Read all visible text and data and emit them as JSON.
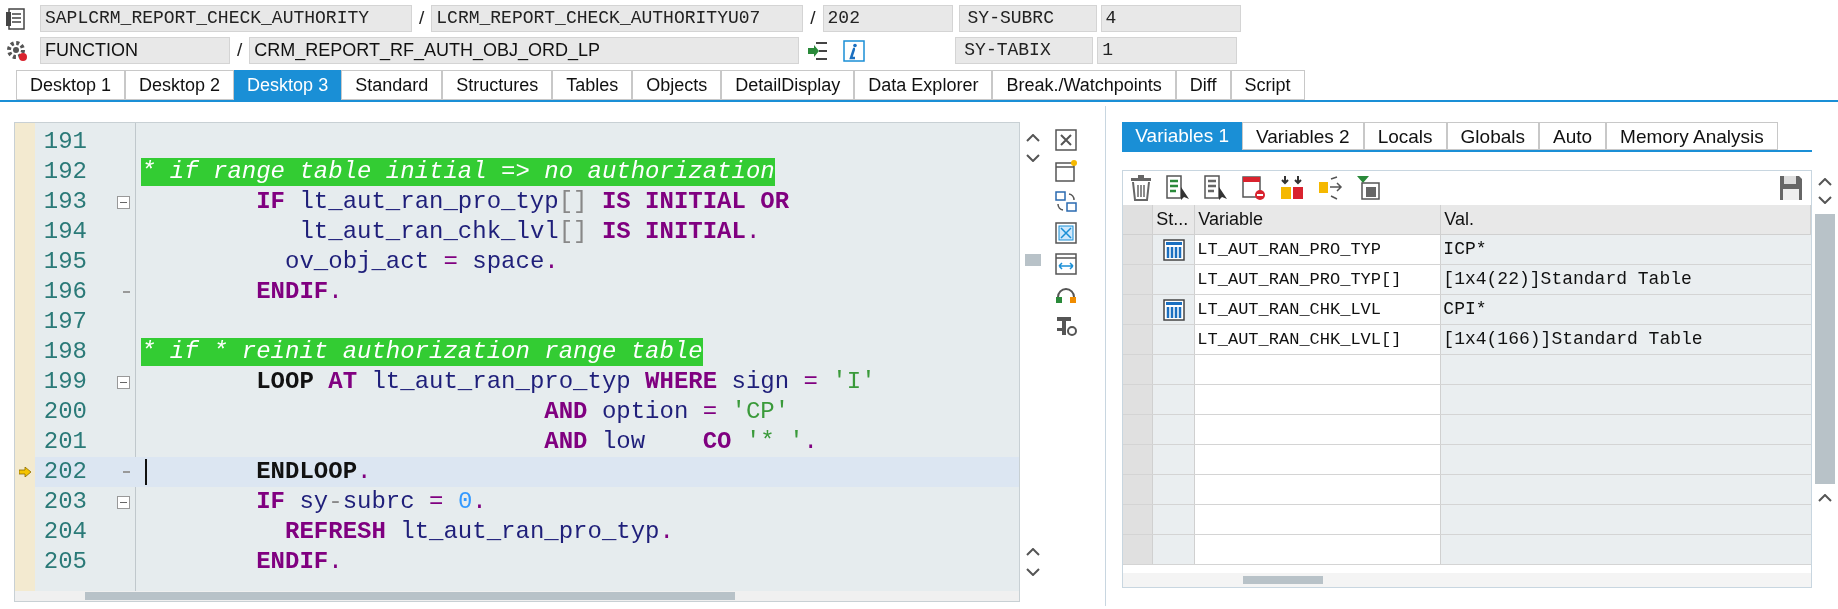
{
  "header": {
    "rows": [
      {
        "fields": [
          {
            "kind": "mono",
            "text": "SAPLCRM_REPORT_CHECK_AUTHORITY"
          },
          {
            "kind": "sep",
            "text": "/"
          },
          {
            "kind": "mono",
            "text": "LCRM_REPORT_CHECK_AUTHORITYU07"
          },
          {
            "kind": "sep",
            "text": "/"
          },
          {
            "kind": "mono",
            "text": "202"
          },
          {
            "kind": "label",
            "text": "SY-SUBRC"
          },
          {
            "kind": "mono",
            "text": "4"
          }
        ]
      },
      {
        "fields": [
          {
            "kind": "sans",
            "text": "FUNCTION"
          },
          {
            "kind": "sep",
            "text": "/"
          },
          {
            "kind": "sans",
            "text": "CRM_REPORT_RF_AUTH_OBJ_ORD_LP"
          },
          {
            "kind": "tools"
          },
          {
            "kind": "label",
            "text": "SY-TABIX"
          },
          {
            "kind": "mono",
            "text": "1"
          }
        ]
      }
    ]
  },
  "tabs": [
    {
      "label": "Desktop 1",
      "selected": false
    },
    {
      "label": "Desktop 2",
      "selected": false
    },
    {
      "label": "Desktop 3",
      "selected": true
    },
    {
      "label": "Standard",
      "selected": false
    },
    {
      "label": "Structures",
      "selected": false
    },
    {
      "label": "Tables",
      "selected": false
    },
    {
      "label": "Objects",
      "selected": false
    },
    {
      "label": "DetailDisplay",
      "selected": false
    },
    {
      "label": "Data Explorer",
      "selected": false
    },
    {
      "label": "Break./Watchpoints",
      "selected": false
    },
    {
      "label": "Diff",
      "selected": false
    },
    {
      "label": "Script",
      "selected": false
    }
  ],
  "code": {
    "lines": [
      {
        "number": "191",
        "current": false,
        "collapsible": false,
        "block_end": false
      },
      {
        "number": "192",
        "current": false,
        "collapsible": false,
        "block_end": false,
        "tokens": [
          {
            "kind": "comment",
            "text": "* if range table initial => no authorization"
          }
        ]
      },
      {
        "number": "193",
        "current": false,
        "collapsible": true,
        "block_end": false,
        "tokens": [
          {
            "kind": "kw",
            "text": "        IF"
          },
          {
            "kind": "id",
            "text": " lt_aut_ran_pro_typ"
          },
          {
            "kind": "gray",
            "text": "[]"
          },
          {
            "kind": "kw",
            "text": " IS INITIAL OR"
          }
        ]
      },
      {
        "number": "194",
        "current": false,
        "collapsible": false,
        "block_end": false,
        "tokens": [
          {
            "kind": "id",
            "text": "           lt_aut_ran_chk_lvl"
          },
          {
            "kind": "gray",
            "text": "[]"
          },
          {
            "kind": "kw",
            "text": " IS INITIAL"
          },
          {
            "kind": "op",
            "text": "."
          }
        ]
      },
      {
        "number": "195",
        "current": false,
        "collapsible": false,
        "block_end": false,
        "tokens": [
          {
            "kind": "id",
            "text": "          ov_obj_act"
          },
          {
            "kind": "op",
            "text": " ="
          },
          {
            "kind": "id",
            "text": " space"
          },
          {
            "kind": "op",
            "text": "."
          }
        ]
      },
      {
        "number": "196",
        "current": false,
        "collapsible": false,
        "block_end": true,
        "tokens": [
          {
            "kind": "kw",
            "text": "        ENDIF"
          },
          {
            "kind": "op",
            "text": "."
          }
        ]
      },
      {
        "number": "197",
        "current": false,
        "collapsible": false,
        "block_end": false
      },
      {
        "number": "198",
        "current": false,
        "collapsible": false,
        "block_end": false,
        "tokens": [
          {
            "kind": "comment",
            "text": "* if * reinit authorization range table"
          }
        ]
      },
      {
        "number": "199",
        "current": false,
        "collapsible": true,
        "block_end": false,
        "tokens": [
          {
            "kind": "kwb",
            "text": "        LOOP"
          },
          {
            "kind": "kw",
            "text": " AT"
          },
          {
            "kind": "id",
            "text": " lt_aut_ran_pro_typ"
          },
          {
            "kind": "kw",
            "text": " WHERE"
          },
          {
            "kind": "id",
            "text": " sign"
          },
          {
            "kind": "op",
            "text": " ="
          },
          {
            "kind": "str",
            "text": " 'I'"
          }
        ]
      },
      {
        "number": "200",
        "current": false,
        "collapsible": false,
        "block_end": false,
        "tokens": [
          {
            "kind": "kw",
            "text": "                            AND"
          },
          {
            "kind": "id",
            "text": " option"
          },
          {
            "kind": "op",
            "text": " ="
          },
          {
            "kind": "str",
            "text": " 'CP'"
          }
        ]
      },
      {
        "number": "201",
        "current": false,
        "collapsible": false,
        "block_end": false,
        "tokens": [
          {
            "kind": "kw",
            "text": "                            AND"
          },
          {
            "kind": "id",
            "text": " low"
          },
          {
            "kind": "kw",
            "text": "    CO"
          },
          {
            "kind": "str",
            "text": " '* '"
          },
          {
            "kind": "op",
            "text": "."
          }
        ]
      },
      {
        "number": "202",
        "current": true,
        "collapsible": false,
        "block_end": true,
        "tokens": [
          {
            "kind": "kwb",
            "text": "        ENDLOOP"
          },
          {
            "kind": "op",
            "text": "."
          }
        ]
      },
      {
        "number": "203",
        "current": false,
        "collapsible": true,
        "block_end": false,
        "tokens": [
          {
            "kind": "kw",
            "text": "        IF"
          },
          {
            "kind": "id",
            "text": " sy"
          },
          {
            "kind": "gray",
            "text": "-"
          },
          {
            "kind": "id",
            "text": "subrc"
          },
          {
            "kind": "op",
            "text": " ="
          },
          {
            "kind": "num",
            "text": " 0"
          },
          {
            "kind": "op",
            "text": "."
          }
        ]
      },
      {
        "number": "204",
        "current": false,
        "collapsible": false,
        "block_end": false,
        "tokens": [
          {
            "kind": "kw",
            "text": "          REFRESH"
          },
          {
            "kind": "id",
            "text": " lt_aut_ran_pro_typ"
          },
          {
            "kind": "op",
            "text": "."
          }
        ]
      },
      {
        "number": "205",
        "current": false,
        "collapsible": false,
        "block_end": false,
        "tokens": [
          {
            "kind": "kw",
            "text": "        ENDIF"
          },
          {
            "kind": "op",
            "text": "."
          }
        ]
      }
    ]
  },
  "variables": {
    "tabs": [
      {
        "label": "Variables 1",
        "selected": true
      },
      {
        "label": "Variables 2",
        "selected": false
      },
      {
        "label": "Locals",
        "selected": false
      },
      {
        "label": "Globals",
        "selected": false
      },
      {
        "label": "Auto",
        "selected": false
      },
      {
        "label": "Memory Analysis",
        "selected": false
      }
    ],
    "columns": [
      "St...",
      "Variable",
      "Val."
    ],
    "rows": [
      {
        "status_icon": true,
        "variable": "LT_AUT_RAN_PRO_TYP",
        "value": "ICP*"
      },
      {
        "status_icon": false,
        "variable": "LT_AUT_RAN_PRO_TYP[]",
        "value": "[1x4(22)]Standard Table"
      },
      {
        "status_icon": true,
        "variable": "LT_AUT_RAN_CHK_LVL",
        "value": "CPI*"
      },
      {
        "status_icon": false,
        "variable": "LT_AUT_RAN_CHK_LVL[]",
        "value": "[1x4(166)]Standard Table"
      }
    ]
  }
}
